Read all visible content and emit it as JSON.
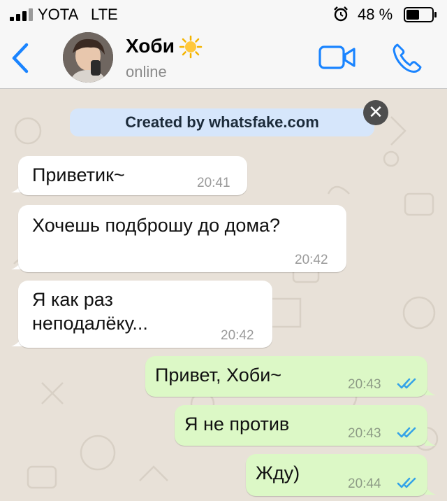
{
  "status_bar": {
    "carrier": "YOTA",
    "network": "LTE",
    "battery_percent": "48 %"
  },
  "header": {
    "contact_name": "Хоби",
    "contact_status": "online",
    "name_emoji_icon": "sun-icon",
    "icons": [
      "back-icon",
      "video-call-icon",
      "phone-call-icon"
    ]
  },
  "chat": {
    "banner": "Created by whatsfake.com",
    "close_label": "✕",
    "messages": [
      {
        "direction": "in",
        "text": "Приветик~",
        "time": "20:41"
      },
      {
        "direction": "in",
        "text": "Хочешь подброшу до дома?",
        "time": "20:42"
      },
      {
        "direction": "in",
        "text": "Я как раз\nнеподалёку...",
        "time": "20:42"
      },
      {
        "direction": "out",
        "text": "Привет, Хоби~",
        "time": "20:43",
        "read": true
      },
      {
        "direction": "out",
        "text": "Я не против",
        "time": "20:43",
        "read": true
      },
      {
        "direction": "out",
        "text": "Жду)",
        "time": "20:44",
        "read": true
      }
    ]
  },
  "colors": {
    "accent": "#1a84ff",
    "incoming_bubble": "#ffffff",
    "outgoing_bubble": "#dcf8c6",
    "read_ticks": "#34a3e8",
    "chat_background": "#e8e1d8"
  }
}
